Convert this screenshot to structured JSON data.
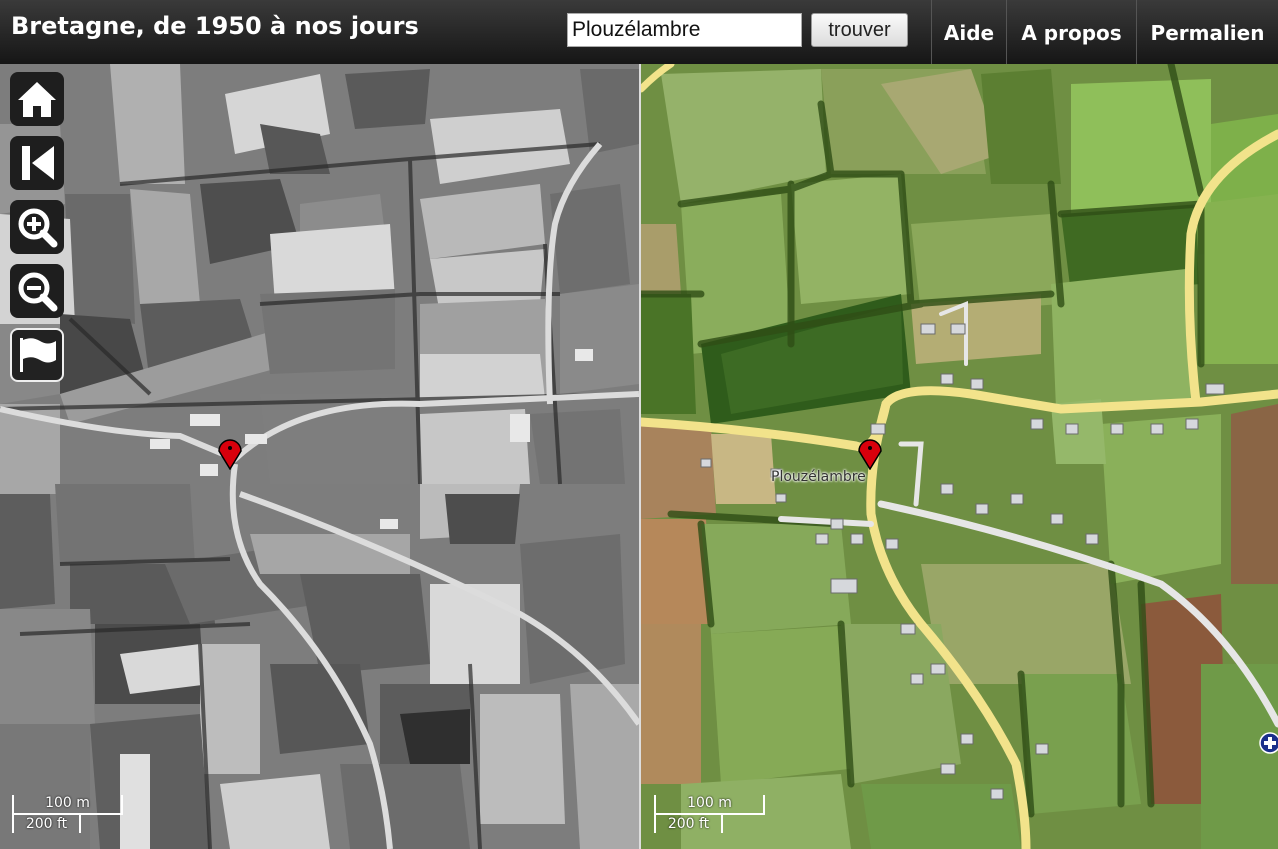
{
  "header": {
    "title": "Bretagne, de 1950 à nos jours"
  },
  "search": {
    "value": "Plouzélambre",
    "button_label": "trouver"
  },
  "nav": {
    "items": [
      {
        "label": "Aide"
      },
      {
        "label": "A propos"
      },
      {
        "label": "Permalien"
      }
    ]
  },
  "controls": [
    {
      "icon": "home-icon"
    },
    {
      "icon": "first-icon"
    },
    {
      "icon": "zoom-in-icon"
    },
    {
      "icon": "zoom-out-icon"
    },
    {
      "icon": "flag-icon"
    }
  ],
  "map": {
    "place_label": "Plouzélambre",
    "marker": "map-pin-icon",
    "left_scale": {
      "metric": "100 m",
      "imperial": "200 ft"
    },
    "right_scale": {
      "metric": "100 m",
      "imperial": "200 ft"
    }
  },
  "colors": {
    "road_yellow": "#f2e38b",
    "road_white": "#e6e6e6",
    "marker_red": "#d8000c",
    "poi_blue": "#1a2f8a"
  }
}
